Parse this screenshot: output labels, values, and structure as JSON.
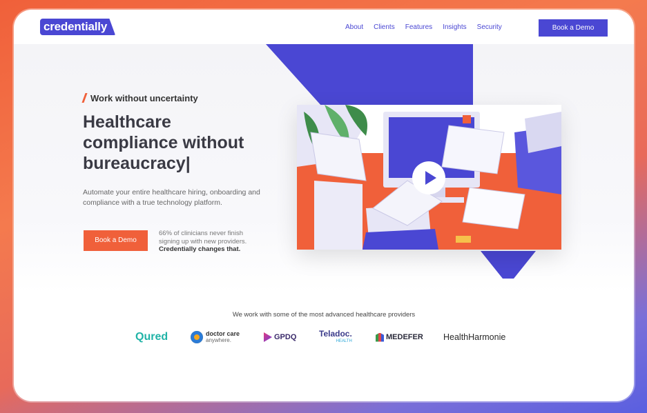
{
  "nav": {
    "logo_text": "credentially",
    "links": [
      "About",
      "Clients",
      "Features",
      "Insights",
      "Security"
    ],
    "cta": "Book a Demo"
  },
  "hero": {
    "eyebrow": "Work without uncertainty",
    "headline_lines": [
      "Healthcare",
      "compliance without",
      "bureaucracy|"
    ],
    "lead_lines": [
      "Automate your entire healthcare hiring, onboarding and",
      "compliance with a true technology platform."
    ],
    "cta": "Book a Demo",
    "note_lines": [
      "66% of clinicians never finish",
      "signing up with new providers."
    ],
    "note_bold": "Credentially changes that.",
    "video_play_icon": "play-icon"
  },
  "partners": {
    "title": "We work with some of the most advanced healthcare providers",
    "logos": [
      "Qured",
      "doctor care",
      "anywhere.",
      "GPDQ",
      "Teladoc.",
      "HEALTH",
      "MEDEFER",
      "HealthHarmonie"
    ]
  },
  "colors": {
    "brand": "#4a47d3",
    "accent": "#f0603a"
  }
}
